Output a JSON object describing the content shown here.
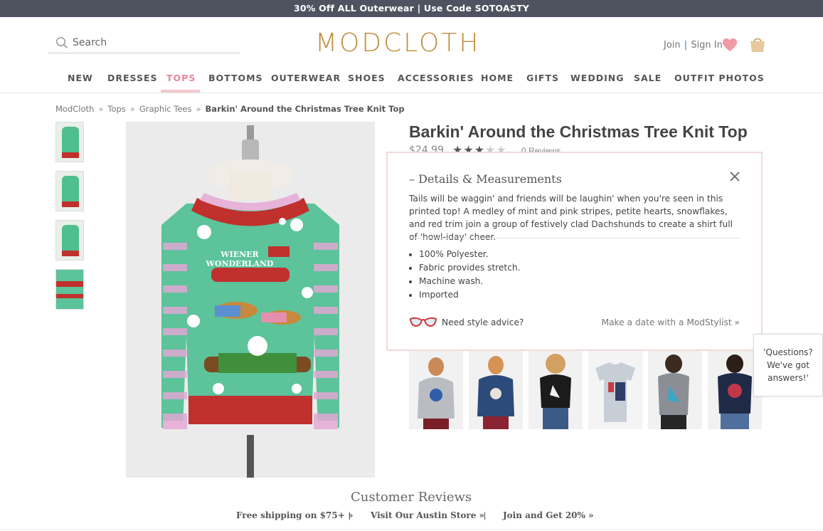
{
  "promo": {
    "text": "30% Off ALL Outerwear | Use Code SOTOASTY"
  },
  "header": {
    "search_placeholder": "Search",
    "logo": "MODCLOTH",
    "join_label": "Join",
    "separator": "|",
    "signin_label": "Sign In"
  },
  "nav": {
    "items": [
      "NEW",
      "DRESSES",
      "TOPS",
      "BOTTOMS",
      "OUTERWEAR",
      "SHOES",
      "ACCESSORIES",
      "HOME",
      "GIFTS",
      "WEDDING",
      "SALE",
      "OUTFIT PHOTOS"
    ],
    "active": "TOPS"
  },
  "breadcrumb": {
    "items": [
      "ModCloth",
      "Tops",
      "Graphic Tees"
    ],
    "separator": "»",
    "current": "Barkin' Around the Christmas Tree Knit Top"
  },
  "product": {
    "title": "Barkin' Around the Christmas Tree Knit Top",
    "price": "$24.99",
    "rating": 3,
    "rating_max": 5,
    "review_count": "0 Reviews",
    "image_text": [
      "WIENER",
      "WONDERLAND"
    ]
  },
  "details": {
    "heading": "– Details & Measurements",
    "description": "Tails will be waggin' and friends will be laughin' when you're seen in this printed top! A medley of mint and pink stripes, petite hearts, snowflakes, and red trim join a group of festively clad Dachshunds to create a shirt full of 'howl-iday' cheer.",
    "bullets": [
      "100% Polyester.",
      "Fabric provides stretch.",
      "Machine wash.",
      "Imported"
    ],
    "advice_label": "Need style advice?",
    "stylist_link": "Make a date with a ModStylist »"
  },
  "chat": {
    "line1": "'Questions?",
    "line2": "We've got",
    "line3": "answers!'"
  },
  "reviews": {
    "title": "Customer Reviews"
  },
  "footer": {
    "links": [
      "Free shipping on $75+ »",
      "Visit Our Austin Store »",
      "Join and Get 20% »"
    ],
    "separator": "|"
  },
  "colors": {
    "promo_bg": "#4f5360",
    "logo_gold": "#c08c3e",
    "accent_pink": "#e8859a",
    "panel_border": "#f4d8d8",
    "sweater_green": "#5cc39a",
    "sweater_red": "#c0302d"
  }
}
